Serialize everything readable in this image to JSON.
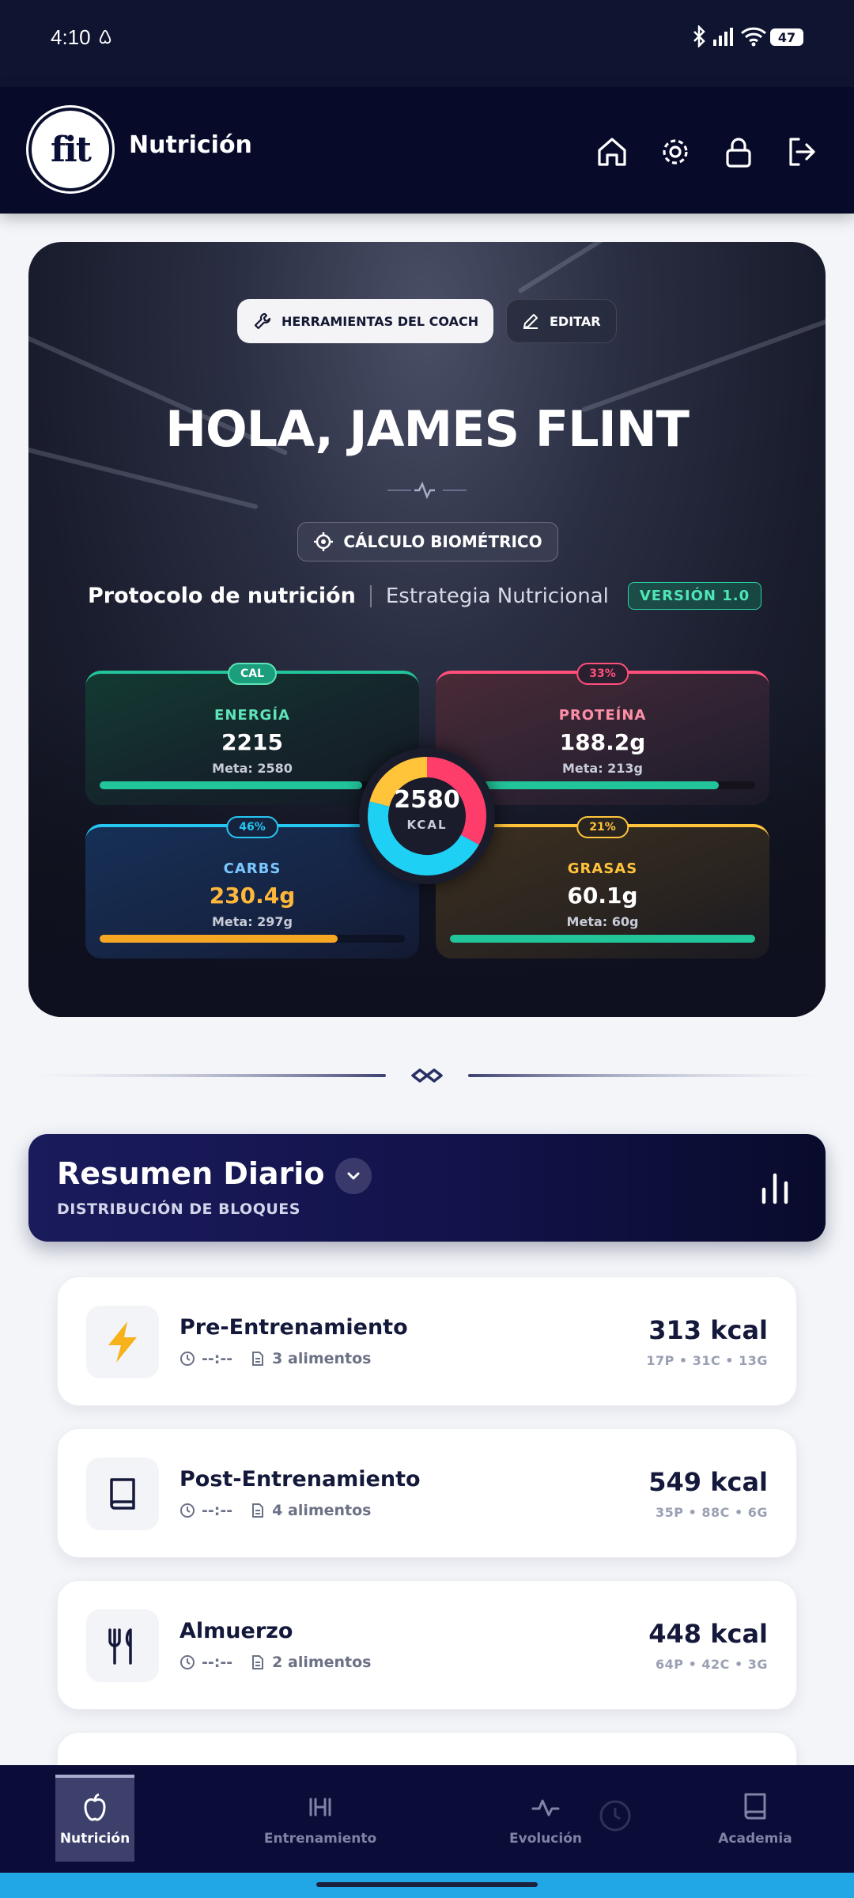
{
  "status_bar": {
    "time": "4:10",
    "battery": "47"
  },
  "header": {
    "title": "Nutrición",
    "logo_text": "fit"
  },
  "hero": {
    "tools_button": "HERRAMIENTAS DEL COACH",
    "edit_button": "EDITAR",
    "greeting": "HOLA, JAMES FLINT",
    "biometric_button": "CÁLCULO BIOMÉTRICO",
    "protocol_title": "Protocolo de nutrición",
    "protocol_strategy": "Estrategia Nutricional",
    "version": "VERSIÓN 1.0",
    "donut": {
      "total": "2580",
      "unit": "KCAL",
      "protein_pct": 33,
      "carbs_pct": 46,
      "fat_pct": 21
    },
    "macros": [
      {
        "tag": "CAL",
        "label": "ENERGÍA",
        "value": "2215",
        "meta": "Meta: 2580",
        "progress": 0.86,
        "color": "#22c49a",
        "label_color": "#5fe3b9"
      },
      {
        "tag": "33%",
        "label": "PROTEÍNA",
        "value": "188.2g",
        "meta": "Meta: 213g",
        "progress": 0.88,
        "color": "#22c49a",
        "label_color": "#ff7a96"
      },
      {
        "tag": "46%",
        "label": "CARBS",
        "value": "230.4g",
        "meta": "Meta: 297g",
        "progress": 0.78,
        "color": "#f5a623",
        "label_color": "#7cc6ff"
      },
      {
        "tag": "21%",
        "label": "GRASAS",
        "value": "60.1g",
        "meta": "Meta: 60g",
        "progress": 1.0,
        "color": "#22c49a",
        "label_color": "#ffc43a"
      }
    ]
  },
  "summary": {
    "title": "Resumen Diario",
    "subtitle": "DISTRIBUCIÓN DE BLOQUES"
  },
  "meals": [
    {
      "name": "Pre-Entrenamiento",
      "time": "--:--",
      "items": "3 alimentos",
      "kcal": "313 kcal",
      "macros": "17P • 31C • 13G",
      "icon": "lightning-icon"
    },
    {
      "name": "Post-Entrenamiento",
      "time": "--:--",
      "items": "4 alimentos",
      "kcal": "549 kcal",
      "macros": "35P • 88C • 6G",
      "icon": "book-icon"
    },
    {
      "name": "Almuerzo",
      "time": "--:--",
      "items": "2 alimentos",
      "kcal": "448 kcal",
      "macros": "64P • 42C • 3G",
      "icon": "cutlery-icon"
    }
  ],
  "bottom_nav": [
    {
      "label": "Nutrición",
      "icon": "apple-icon",
      "active": true
    },
    {
      "label": "Entrenamiento",
      "icon": "dumbbell-icon",
      "active": false
    },
    {
      "label": "Evolución",
      "icon": "pulse-icon",
      "active": false
    },
    {
      "label": "Academia",
      "icon": "book-icon",
      "active": false
    }
  ]
}
